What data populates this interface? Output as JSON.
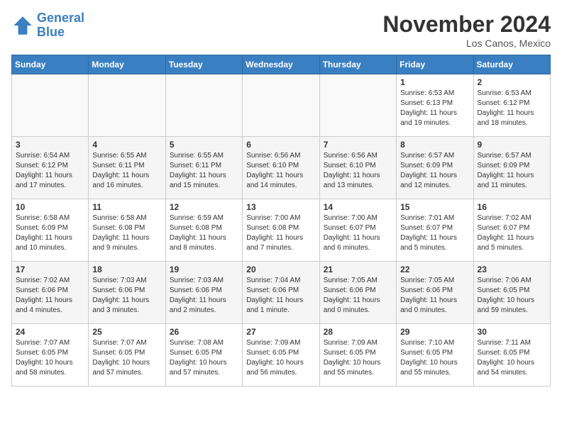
{
  "header": {
    "logo_line1": "General",
    "logo_line2": "Blue",
    "month": "November 2024",
    "location": "Los Canos, Mexico"
  },
  "weekdays": [
    "Sunday",
    "Monday",
    "Tuesday",
    "Wednesday",
    "Thursday",
    "Friday",
    "Saturday"
  ],
  "weeks": [
    [
      {
        "day": "",
        "info": ""
      },
      {
        "day": "",
        "info": ""
      },
      {
        "day": "",
        "info": ""
      },
      {
        "day": "",
        "info": ""
      },
      {
        "day": "",
        "info": ""
      },
      {
        "day": "1",
        "info": "Sunrise: 6:53 AM\nSunset: 6:13 PM\nDaylight: 11 hours\nand 19 minutes."
      },
      {
        "day": "2",
        "info": "Sunrise: 6:53 AM\nSunset: 6:12 PM\nDaylight: 11 hours\nand 18 minutes."
      }
    ],
    [
      {
        "day": "3",
        "info": "Sunrise: 6:54 AM\nSunset: 6:12 PM\nDaylight: 11 hours\nand 17 minutes."
      },
      {
        "day": "4",
        "info": "Sunrise: 6:55 AM\nSunset: 6:11 PM\nDaylight: 11 hours\nand 16 minutes."
      },
      {
        "day": "5",
        "info": "Sunrise: 6:55 AM\nSunset: 6:11 PM\nDaylight: 11 hours\nand 15 minutes."
      },
      {
        "day": "6",
        "info": "Sunrise: 6:56 AM\nSunset: 6:10 PM\nDaylight: 11 hours\nand 14 minutes."
      },
      {
        "day": "7",
        "info": "Sunrise: 6:56 AM\nSunset: 6:10 PM\nDaylight: 11 hours\nand 13 minutes."
      },
      {
        "day": "8",
        "info": "Sunrise: 6:57 AM\nSunset: 6:09 PM\nDaylight: 11 hours\nand 12 minutes."
      },
      {
        "day": "9",
        "info": "Sunrise: 6:57 AM\nSunset: 6:09 PM\nDaylight: 11 hours\nand 11 minutes."
      }
    ],
    [
      {
        "day": "10",
        "info": "Sunrise: 6:58 AM\nSunset: 6:09 PM\nDaylight: 11 hours\nand 10 minutes."
      },
      {
        "day": "11",
        "info": "Sunrise: 6:58 AM\nSunset: 6:08 PM\nDaylight: 11 hours\nand 9 minutes."
      },
      {
        "day": "12",
        "info": "Sunrise: 6:59 AM\nSunset: 6:08 PM\nDaylight: 11 hours\nand 8 minutes."
      },
      {
        "day": "13",
        "info": "Sunrise: 7:00 AM\nSunset: 6:08 PM\nDaylight: 11 hours\nand 7 minutes."
      },
      {
        "day": "14",
        "info": "Sunrise: 7:00 AM\nSunset: 6:07 PM\nDaylight: 11 hours\nand 6 minutes."
      },
      {
        "day": "15",
        "info": "Sunrise: 7:01 AM\nSunset: 6:07 PM\nDaylight: 11 hours\nand 5 minutes."
      },
      {
        "day": "16",
        "info": "Sunrise: 7:02 AM\nSunset: 6:07 PM\nDaylight: 11 hours\nand 5 minutes."
      }
    ],
    [
      {
        "day": "17",
        "info": "Sunrise: 7:02 AM\nSunset: 6:06 PM\nDaylight: 11 hours\nand 4 minutes."
      },
      {
        "day": "18",
        "info": "Sunrise: 7:03 AM\nSunset: 6:06 PM\nDaylight: 11 hours\nand 3 minutes."
      },
      {
        "day": "19",
        "info": "Sunrise: 7:03 AM\nSunset: 6:06 PM\nDaylight: 11 hours\nand 2 minutes."
      },
      {
        "day": "20",
        "info": "Sunrise: 7:04 AM\nSunset: 6:06 PM\nDaylight: 11 hours\nand 1 minute."
      },
      {
        "day": "21",
        "info": "Sunrise: 7:05 AM\nSunset: 6:06 PM\nDaylight: 11 hours\nand 0 minutes."
      },
      {
        "day": "22",
        "info": "Sunrise: 7:05 AM\nSunset: 6:06 PM\nDaylight: 11 hours\nand 0 minutes."
      },
      {
        "day": "23",
        "info": "Sunrise: 7:06 AM\nSunset: 6:05 PM\nDaylight: 10 hours\nand 59 minutes."
      }
    ],
    [
      {
        "day": "24",
        "info": "Sunrise: 7:07 AM\nSunset: 6:05 PM\nDaylight: 10 hours\nand 58 minutes."
      },
      {
        "day": "25",
        "info": "Sunrise: 7:07 AM\nSunset: 6:05 PM\nDaylight: 10 hours\nand 57 minutes."
      },
      {
        "day": "26",
        "info": "Sunrise: 7:08 AM\nSunset: 6:05 PM\nDaylight: 10 hours\nand 57 minutes."
      },
      {
        "day": "27",
        "info": "Sunrise: 7:09 AM\nSunset: 6:05 PM\nDaylight: 10 hours\nand 56 minutes."
      },
      {
        "day": "28",
        "info": "Sunrise: 7:09 AM\nSunset: 6:05 PM\nDaylight: 10 hours\nand 55 minutes."
      },
      {
        "day": "29",
        "info": "Sunrise: 7:10 AM\nSunset: 6:05 PM\nDaylight: 10 hours\nand 55 minutes."
      },
      {
        "day": "30",
        "info": "Sunrise: 7:11 AM\nSunset: 6:05 PM\nDaylight: 10 hours\nand 54 minutes."
      }
    ]
  ]
}
